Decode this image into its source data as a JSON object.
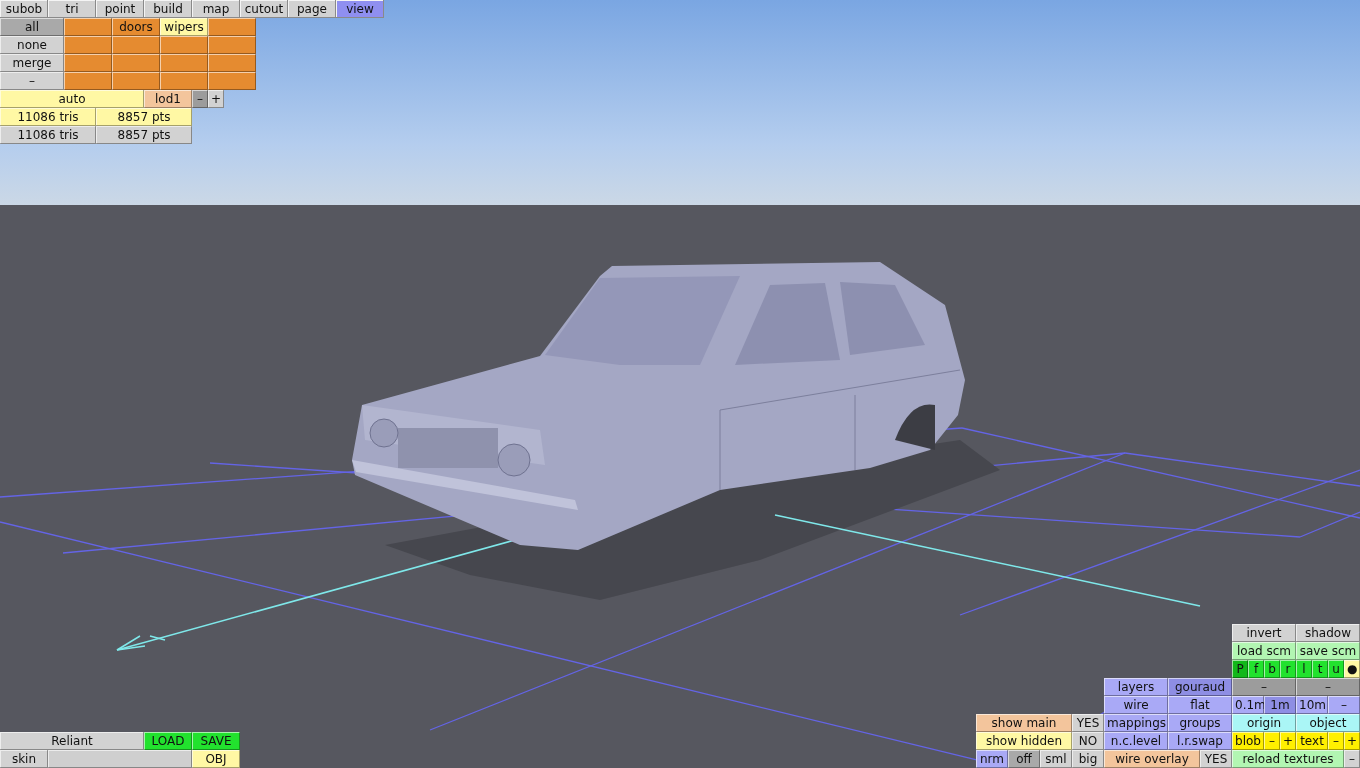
{
  "tabs": [
    {
      "label": "subob",
      "selected": false
    },
    {
      "label": "tri",
      "selected": false
    },
    {
      "label": "point",
      "selected": false
    },
    {
      "label": "build",
      "selected": false
    },
    {
      "label": "map",
      "selected": false
    },
    {
      "label": "cutout",
      "selected": false
    },
    {
      "label": "page",
      "selected": false
    },
    {
      "label": "view",
      "selected": true
    }
  ],
  "subobject_panel": {
    "strips": [
      {
        "buttons": [
          {
            "label": "all",
            "kind": "grey-on"
          },
          {
            "kind": "orange"
          },
          {
            "label": "doors",
            "kind": "orange"
          },
          {
            "label": "wipers",
            "kind": "yellow"
          },
          {
            "kind": "orange"
          }
        ]
      },
      {
        "buttons": [
          {
            "label": "none",
            "kind": "grey"
          },
          {
            "kind": "orange"
          },
          {
            "kind": "orange"
          },
          {
            "kind": "orange"
          },
          {
            "kind": "orange"
          }
        ]
      },
      {
        "buttons": [
          {
            "label": "merge",
            "kind": "grey"
          },
          {
            "kind": "orange"
          },
          {
            "kind": "orange"
          },
          {
            "kind": "orange"
          },
          {
            "kind": "orange"
          }
        ]
      },
      {
        "buttons": [
          {
            "label": "–",
            "kind": "grey"
          },
          {
            "kind": "orange"
          },
          {
            "kind": "orange"
          },
          {
            "kind": "orange"
          },
          {
            "kind": "orange"
          }
        ]
      },
      {
        "buttons": [
          {
            "label": "auto",
            "kind": "yellow"
          },
          {
            "label": "lod1",
            "kind": "peach"
          },
          {
            "label": "–",
            "kind": "dark"
          },
          {
            "label": "+",
            "kind": "grey"
          }
        ]
      },
      {
        "buttons": [
          {
            "label": "11086 tris",
            "kind": "stat-yellow"
          },
          {
            "label": "8857 pts",
            "kind": "stat-yellow"
          }
        ]
      },
      {
        "buttons": [
          {
            "label": "11086 tris",
            "kind": "stat-grey"
          },
          {
            "label": "8857 pts",
            "kind": "stat-grey"
          }
        ]
      }
    ]
  },
  "file_panel": {
    "strips": [
      {
        "buttons": [
          {
            "label": "Reliant",
            "kind": "grey"
          },
          {
            "label": "LOAD",
            "kind": "green"
          },
          {
            "label": "SAVE",
            "kind": "green"
          }
        ]
      },
      {
        "buttons": [
          {
            "label": "skin",
            "kind": "grey"
          },
          {
            "kind": "field"
          },
          {
            "label": "OBJ",
            "kind": "yellow"
          }
        ]
      }
    ]
  },
  "view_panel": {
    "strips": [
      {
        "buttons": [
          {
            "label": "invert",
            "kind": "grey"
          },
          {
            "label": "shadow",
            "kind": "grey"
          }
        ]
      },
      {
        "buttons": [
          {
            "label": "load scm",
            "kind": "lightgreen"
          },
          {
            "label": "save scm",
            "kind": "lightgreen"
          }
        ]
      },
      {
        "buttons": [
          {
            "label": "P",
            "kind": "green-on"
          },
          {
            "label": "f",
            "kind": "green"
          },
          {
            "label": "b",
            "kind": "green"
          },
          {
            "label": "r",
            "kind": "green"
          },
          {
            "label": "l",
            "kind": "green"
          },
          {
            "label": "t",
            "kind": "green"
          },
          {
            "label": "u",
            "kind": "green"
          },
          {
            "label": "●",
            "kind": "yellow"
          }
        ]
      },
      {
        "buttons": [
          {
            "label": "layers",
            "kind": "blue"
          },
          {
            "label": "gouraud",
            "kind": "blue-on"
          },
          {
            "label": "–",
            "kind": "dark"
          },
          {
            "label": "–",
            "kind": "dark"
          }
        ]
      },
      {
        "buttons": [
          {
            "label": "wire",
            "kind": "blue"
          },
          {
            "label": "flat",
            "kind": "blue"
          },
          {
            "label": "0.1m",
            "kind": "blue"
          },
          {
            "label": "1m",
            "kind": "blue-on"
          },
          {
            "label": "10m",
            "kind": "blue"
          },
          {
            "label": "–",
            "kind": "blue"
          }
        ]
      },
      {
        "buttons": [
          {
            "label": "show main",
            "kind": "peach"
          },
          {
            "label": "YES",
            "kind": "grey"
          },
          {
            "label": "mappings",
            "kind": "blue"
          },
          {
            "label": "groups",
            "kind": "blue"
          },
          {
            "label": "origin",
            "kind": "cyan"
          },
          {
            "label": "object",
            "kind": "cyan"
          }
        ]
      },
      {
        "buttons": [
          {
            "label": "show hidden",
            "kind": "yellow"
          },
          {
            "label": "NO",
            "kind": "grey"
          },
          {
            "label": "n.c.level",
            "kind": "blue"
          },
          {
            "label": "l.r.swap",
            "kind": "blue"
          },
          {
            "label": "blob",
            "kind": "bright-yellow"
          },
          {
            "label": "–",
            "kind": "bright-yellow"
          },
          {
            "label": "+",
            "kind": "bright-yellow"
          },
          {
            "label": "text",
            "kind": "bright-yellow"
          },
          {
            "label": "–",
            "kind": "bright-yellow"
          },
          {
            "label": "+",
            "kind": "bright-yellow"
          }
        ]
      },
      {
        "buttons": [
          {
            "label": "nrm",
            "kind": "blue"
          },
          {
            "label": "off",
            "kind": "grey-on"
          },
          {
            "label": "sml",
            "kind": "grey"
          },
          {
            "label": "big",
            "kind": "grey"
          },
          {
            "label": "wire overlay",
            "kind": "peach"
          },
          {
            "label": "YES",
            "kind": "grey"
          },
          {
            "label": "reload textures",
            "kind": "lightgreen"
          },
          {
            "label": "–",
            "kind": "grey"
          }
        ]
      }
    ]
  }
}
